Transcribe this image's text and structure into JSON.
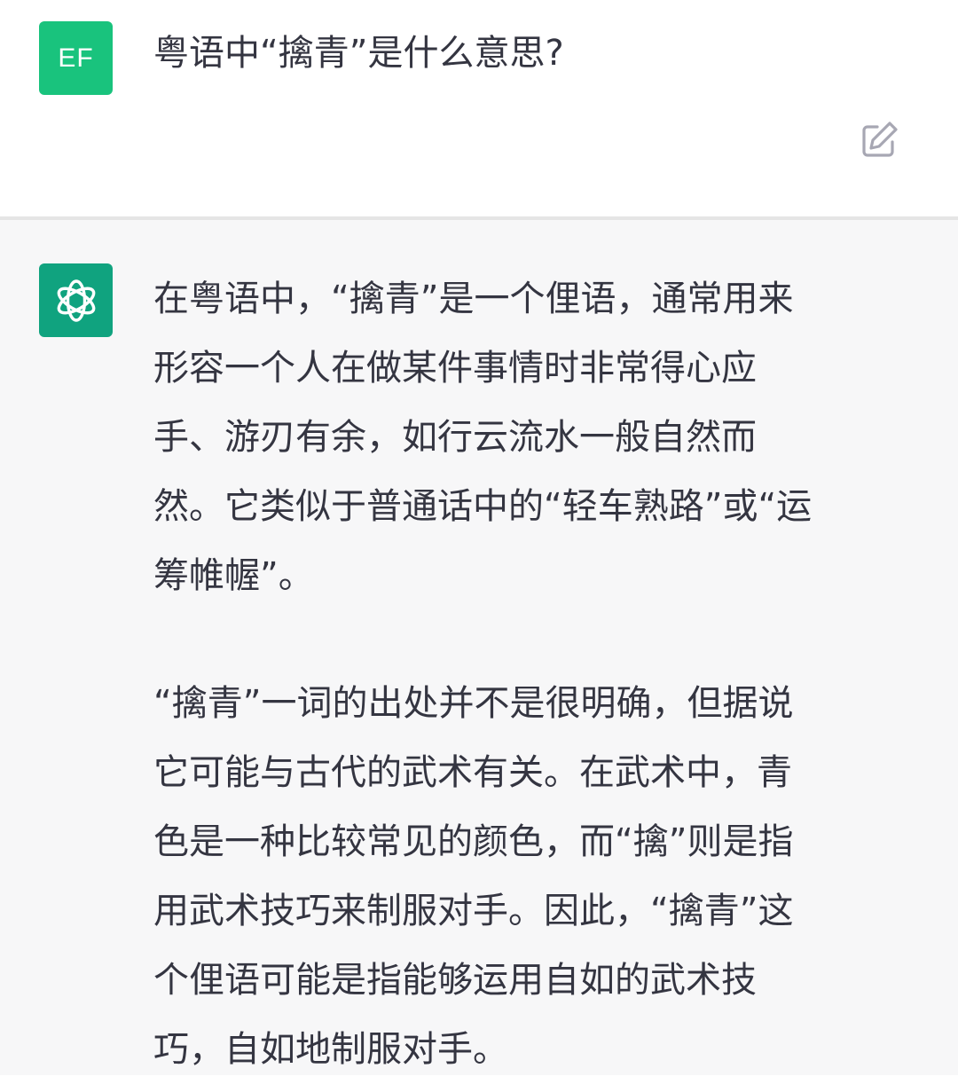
{
  "user": {
    "avatar_initials": "EF",
    "question": "粤语中“擒青”是什么意思?"
  },
  "toolbar": {
    "edit_icon": "edit-icon"
  },
  "assistant": {
    "avatar_icon": "openai-logo-icon",
    "paragraphs": [
      [
        "在粤语中，“擒青”是一个俚语，通常用来",
        "形容一个人在做某件事情时非常得心应",
        "手、游刃有余，如行云流水一般自然而",
        "然。它类似于普通话中的“轻车熟路”或“运",
        "筹帷幄”。"
      ],
      [
        "“擒青”一词的出处并不是很明确，但据说",
        "它可能与古代的武术有关。在武术中，青",
        "色是一种比较常见的颜色，而“擒”则是指",
        "用武术技巧来制服对手。因此，“擒青”这",
        "个俚语可能是指能够运用自如的武术技",
        "巧，自如地制服对手。"
      ]
    ]
  },
  "colors": {
    "user_avatar": "#19c37d",
    "assistant_avatar": "#10a37f",
    "assistant_bg": "#f7f7f8",
    "text": "#343541"
  }
}
